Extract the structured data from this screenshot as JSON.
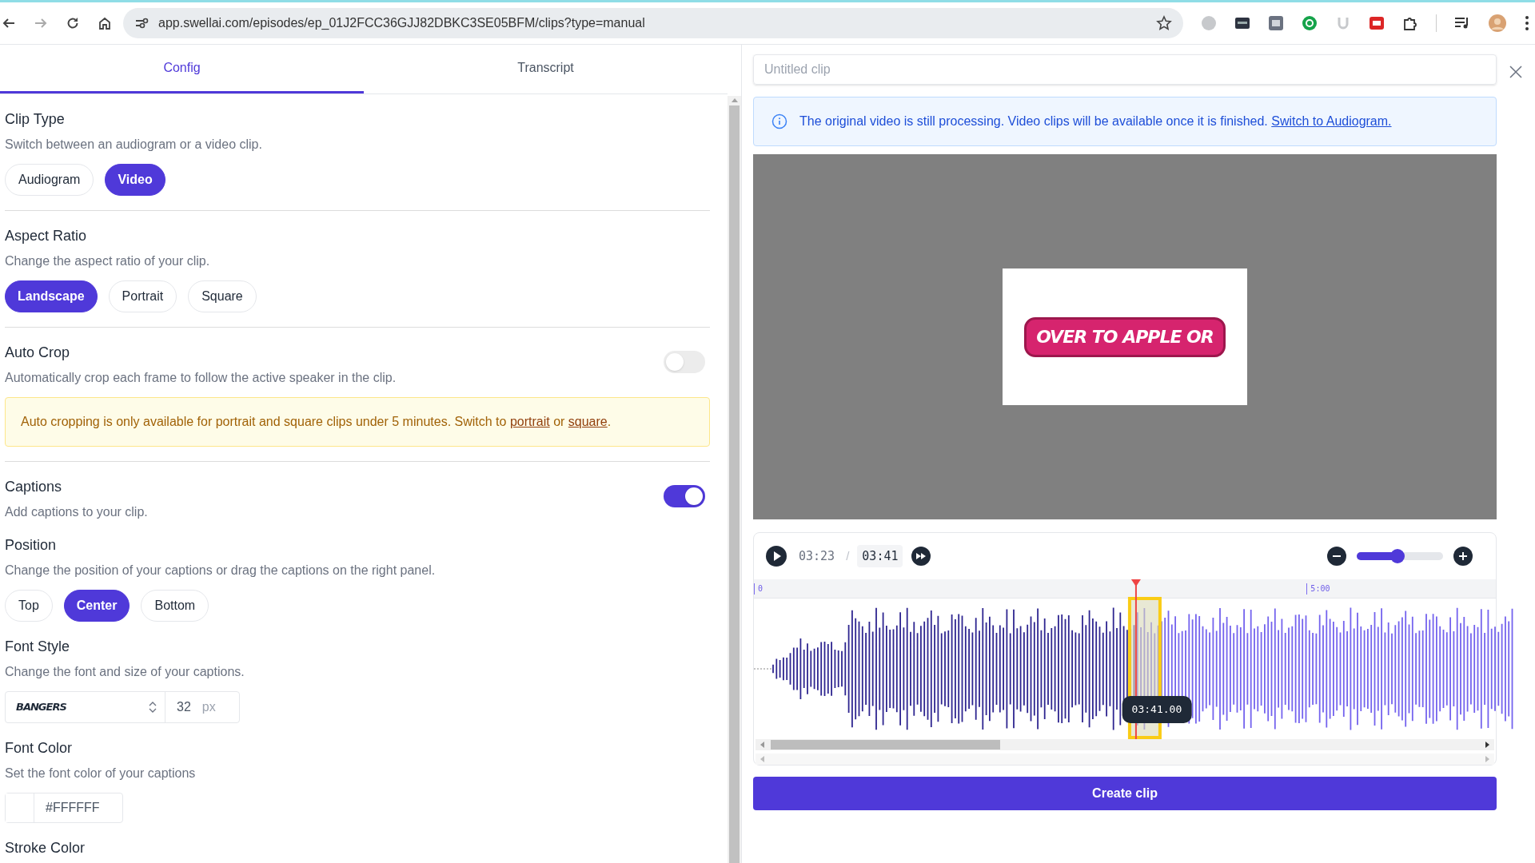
{
  "browser": {
    "url": "app.swellai.com/episodes/ep_01J2FCC36GJJ82DBKC3SE05BFM/clips?type=manual"
  },
  "tabs": [
    {
      "label": "Config",
      "selected": true
    },
    {
      "label": "Transcript",
      "selected": false
    }
  ],
  "section_groups": [
    {
      "sections": [
        {
          "kind": "options",
          "title": "Clip Type",
          "description": "Switch between an audiogram or a video clip.",
          "options": [
            {
              "label": "Audiogram",
              "selected": false
            },
            {
              "label": "Video",
              "selected": true
            }
          ]
        }
      ]
    },
    {
      "sections": [
        {
          "kind": "options",
          "title": "Aspect Ratio",
          "description": "Change the aspect ratio of your clip.",
          "options": [
            {
              "label": "Landscape",
              "selected": true
            },
            {
              "label": "Portrait",
              "selected": false
            },
            {
              "label": "Square",
              "selected": false
            }
          ]
        }
      ]
    },
    {
      "sections": [
        {
          "kind": "toggle",
          "title": "Auto Crop",
          "description": "Automatically crop each frame to follow the active speaker in the clip.",
          "on": false,
          "notice": [
            {
              "kind": "text",
              "text": "Auto cropping is only available for portrait and square clips under 5 minutes. Switch to "
            },
            {
              "kind": "link",
              "text": "portrait"
            },
            {
              "kind": "text",
              "text": " or "
            },
            {
              "kind": "link",
              "text": "square"
            },
            {
              "kind": "text",
              "text": "."
            }
          ]
        }
      ]
    },
    {
      "sections": [
        {
          "kind": "toggle",
          "title": "Captions",
          "description": "Add captions to your clip.",
          "on": true
        },
        {
          "kind": "options",
          "title": "Position",
          "description": "Change the position of your captions or drag the captions on the right panel.",
          "options": [
            {
              "label": "Top",
              "selected": false
            },
            {
              "label": "Center",
              "selected": true
            },
            {
              "label": "Bottom",
              "selected": false
            }
          ]
        },
        {
          "kind": "font",
          "title": "Font Style",
          "description": "Change the font and size of your captions.",
          "font": "BANGERS",
          "size": "32",
          "unit": "px"
        },
        {
          "kind": "color",
          "title": "Font Color",
          "description": "Set the font color of your captions",
          "value": "#FFFFFF"
        },
        {
          "kind": "heading",
          "title": "Stroke Color"
        }
      ]
    }
  ],
  "clip_title": {
    "placeholder": "Untitled clip"
  },
  "processing_notice": {
    "text": "The original video is still processing. Video clips will be available once it is finished. ",
    "link": "Switch to Audiogram."
  },
  "preview": {
    "caption": "OVER TO APPLE OR"
  },
  "player": {
    "current_time": "03:23",
    "separator": "/",
    "end_time": "03:41",
    "zoom": {
      "level": 0.47
    }
  },
  "timeline": {
    "ticks": [
      {
        "label": "0",
        "level": 0.0
      },
      {
        "label": "5:00",
        "level": 0.745
      }
    ],
    "playhead": {
      "level": 0.515
    },
    "tooltip": "03:41.00"
  },
  "create_button": "Create clip"
}
